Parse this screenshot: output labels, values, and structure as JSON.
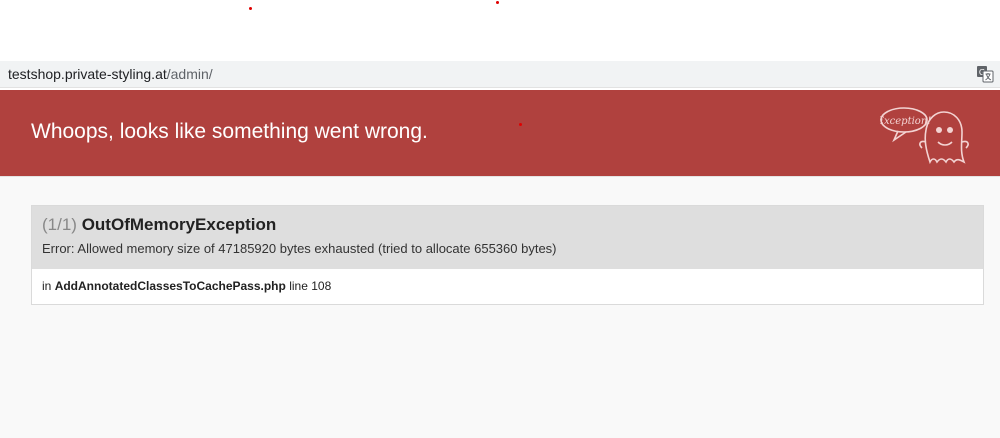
{
  "address_bar": {
    "host": "testshop.private-styling.at",
    "path": "/admin/"
  },
  "header": {
    "title": "Whoops, looks like something went wrong.",
    "badge_text": "Exception!"
  },
  "exception": {
    "count": "(1/1)",
    "class_name": "OutOfMemoryException",
    "message": "Error: Allowed memory size of 47185920 bytes exhausted (tried to allocate 655360 bytes)",
    "trace": {
      "prefix": "in",
      "file": "AddAnnotatedClassesToCachePass.php",
      "line_text": "line 108"
    }
  },
  "colors": {
    "header_bg": "#b0413e",
    "content_bg": "#f9f9f9",
    "exception_head_bg": "#dedede"
  },
  "icons": [
    "translate-icon",
    "exception-ghost-icon"
  ]
}
